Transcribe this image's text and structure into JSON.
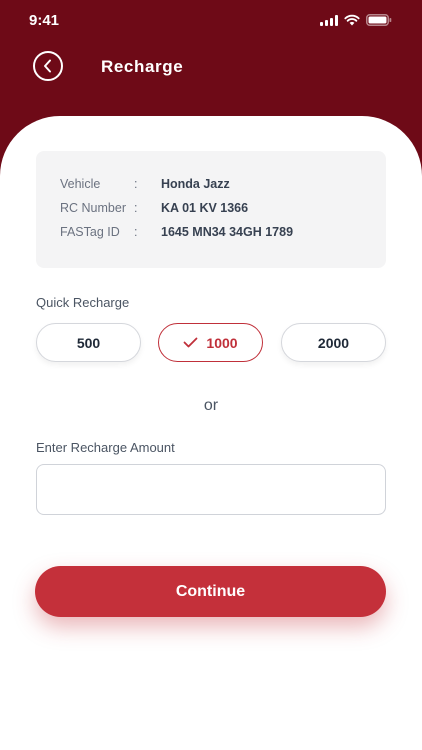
{
  "status": {
    "time": "9:41"
  },
  "header": {
    "title": "Recharge"
  },
  "vehicle_info": {
    "rows": [
      {
        "label": "Vehicle",
        "colon": ":",
        "value": "Honda Jazz"
      },
      {
        "label": "RC Number",
        "colon": ":",
        "value": "KA 01 KV 1366"
      },
      {
        "label": "FASTag ID",
        "colon": ":",
        "value": "1645 MN34 34GH 1789"
      }
    ]
  },
  "quick_recharge": {
    "label": "Quick Recharge",
    "options": [
      "500",
      "1000",
      "2000"
    ],
    "selected": "1000"
  },
  "separator_text": "or",
  "amount_input": {
    "label": "Enter Recharge Amount",
    "value": "",
    "placeholder": ""
  },
  "continue_label": "Continue",
  "colors": {
    "header": "#6e0a17",
    "accent": "#c4303a"
  }
}
